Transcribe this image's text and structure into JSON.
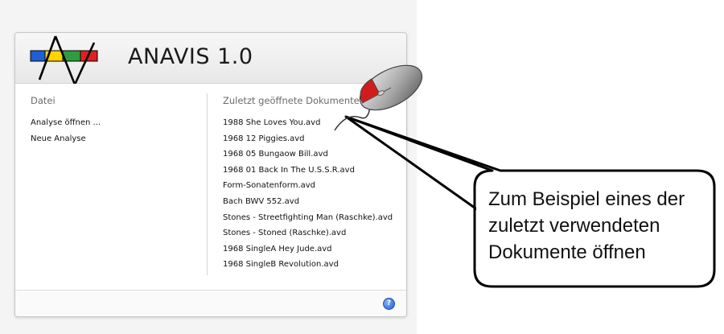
{
  "app": {
    "title": "ANAVIS 1.0"
  },
  "left_column": {
    "title": "Datei",
    "items": [
      "Analyse öffnen ...",
      "Neue Analyse"
    ]
  },
  "right_column": {
    "title": "Zuletzt geöffnete Dokumente",
    "items": [
      "1988 She Loves You.avd",
      "1968 12 Piggies.avd",
      "1968 05 Bungaow Bill.avd",
      "1968 01 Back In The U.S.S.R.avd",
      "Form-Sonatenform.avd",
      "Bach BWV 552.avd",
      "Stones - Streetfighting Man (Raschke).avd",
      "Stones - Stoned (Raschke).avd",
      "1968 SingleA Hey Jude.avd",
      "1968 SingleB Revolution.avd"
    ]
  },
  "footer": {
    "help_icon": "help-icon",
    "help_glyph": "?"
  },
  "callout": {
    "lines": [
      "Zum Beispiel eines der",
      "zuletzt verwendeten",
      "Dokumente öffnen"
    ]
  },
  "colors": {
    "logo_blue": "#1f5fd6",
    "logo_yellow": "#ffd400",
    "logo_green": "#2e9e3c",
    "logo_red": "#e02020",
    "mouse_button": "#d21c1c",
    "help_blue": "#1c5fd0"
  }
}
